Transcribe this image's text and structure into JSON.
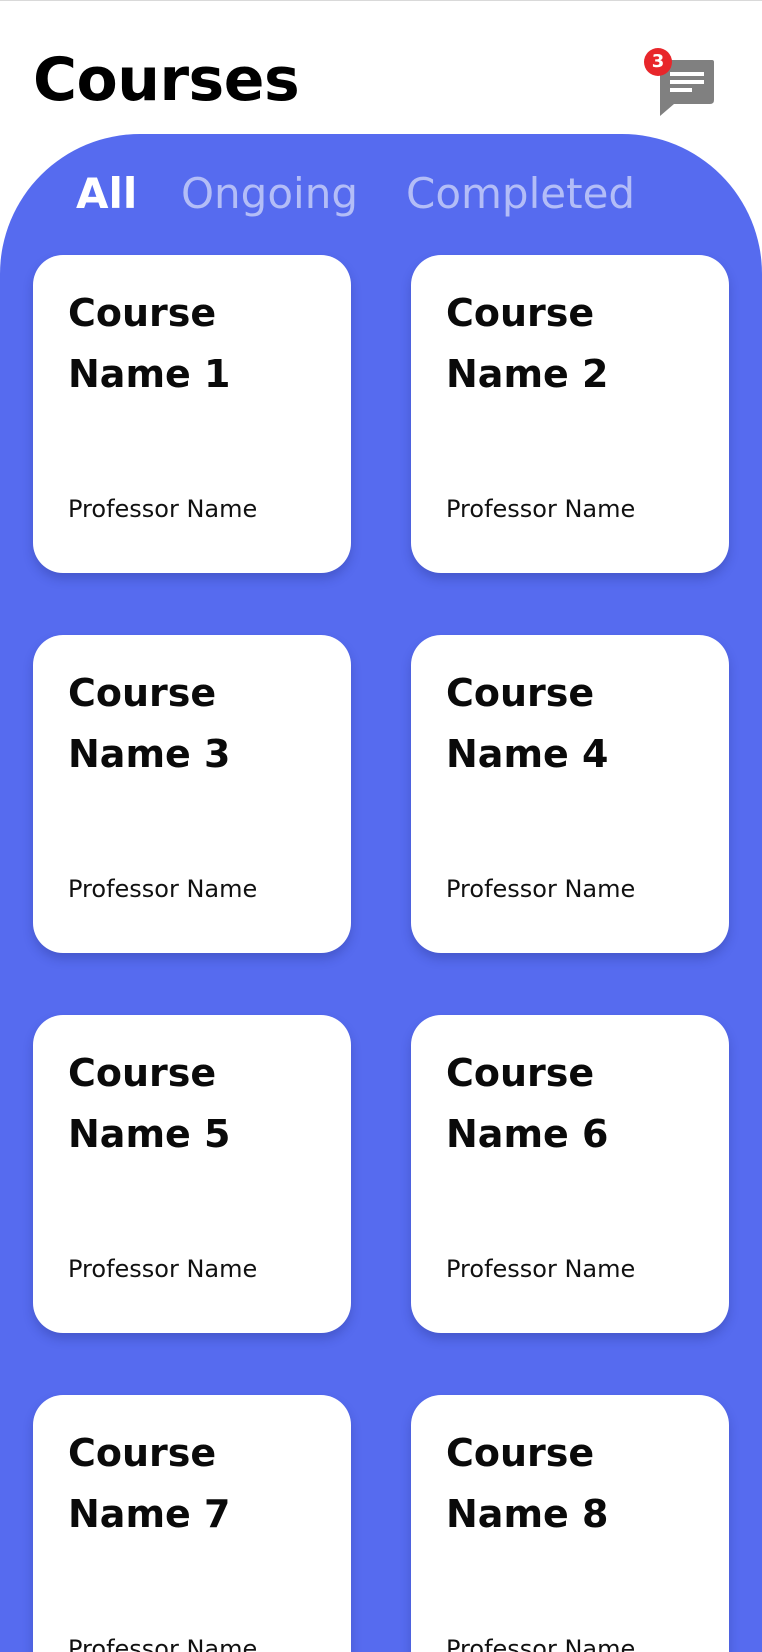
{
  "header": {
    "title": "Courses",
    "messages_icon": "chat-message-icon",
    "unread_count": "3"
  },
  "tabs": [
    {
      "label": "All",
      "active": true
    },
    {
      "label": "Ongoing",
      "active": false
    },
    {
      "label": "Completed",
      "active": false
    }
  ],
  "courses": [
    {
      "name": "Course Name 1",
      "professor": "Professor Name"
    },
    {
      "name": "Course Name 2",
      "professor": "Professor Name"
    },
    {
      "name": "Course Name 3",
      "professor": "Professor Name"
    },
    {
      "name": "Course Name 4",
      "professor": "Professor Name"
    },
    {
      "name": "Course Name 5",
      "professor": "Professor Name"
    },
    {
      "name": "Course Name 6",
      "professor": "Professor Name"
    },
    {
      "name": "Course Name 7",
      "professor": "Professor Name"
    },
    {
      "name": "Course Name 8",
      "professor": "Professor Name"
    }
  ],
  "colors": {
    "accent": "#566bef",
    "badge": "#e8262b",
    "inactive_tab": "#b3bdf7",
    "chat_icon": "#808080"
  }
}
